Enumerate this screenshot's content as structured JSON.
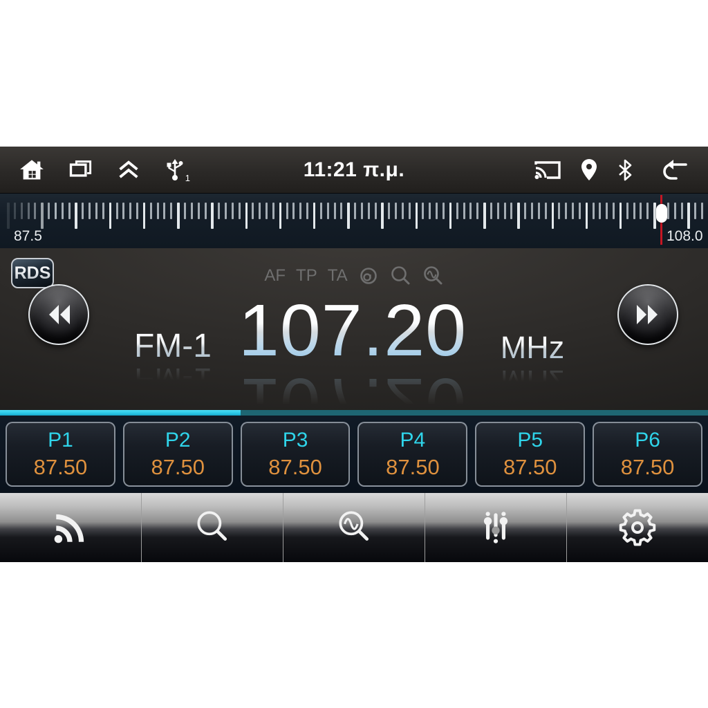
{
  "status_bar": {
    "time": "11:21 π.μ.",
    "usb_count": "1"
  },
  "tuner_scale": {
    "min_label": "87.5",
    "max_label": "108.0",
    "tick_count": 103,
    "major_every": 5,
    "needle_percent": 93.3
  },
  "radio": {
    "rds_badge": "RDS",
    "indicators": [
      "AF",
      "TP",
      "TA"
    ],
    "band": "FM-1",
    "frequency": "107.20",
    "unit": "MHz"
  },
  "tuning_progress": {
    "percent": 34
  },
  "presets": [
    {
      "label": "P1",
      "value": "87.50"
    },
    {
      "label": "P2",
      "value": "87.50"
    },
    {
      "label": "P3",
      "value": "87.50"
    },
    {
      "label": "P4",
      "value": "87.50"
    },
    {
      "label": "P5",
      "value": "87.50"
    },
    {
      "label": "P6",
      "value": "87.50"
    }
  ],
  "colors": {
    "accent_cyan": "#2fd4ea",
    "preset_orange": "#df913e",
    "needle_red": "#c41623",
    "progress_bright": "#2cc9e8",
    "progress_dim": "#1e6673"
  }
}
